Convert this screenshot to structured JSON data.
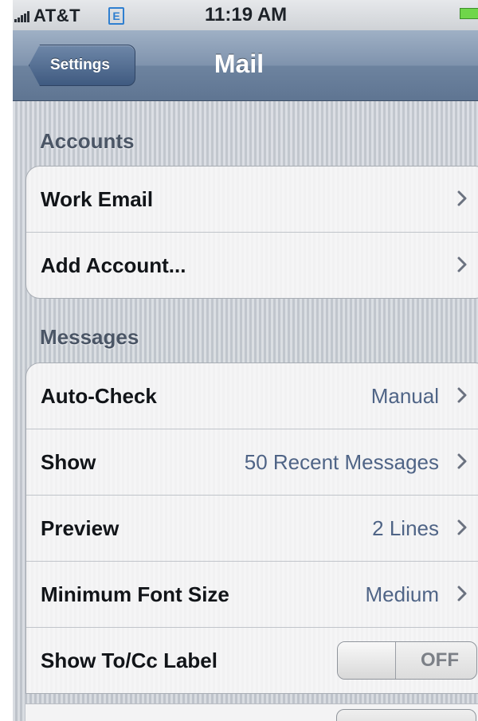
{
  "status_bar": {
    "carrier": "AT&T",
    "network_badge": "E",
    "time": "11:19 AM",
    "signal_icon": "signal-bars-icon",
    "battery_icon": "battery-icon"
  },
  "nav": {
    "back_label": "Settings",
    "title": "Mail"
  },
  "sections": [
    {
      "header": "Accounts",
      "rows": [
        {
          "label": "Work Email",
          "value": "",
          "chevron": true
        },
        {
          "label": "Add Account...",
          "value": "",
          "chevron": true
        }
      ]
    },
    {
      "header": "Messages",
      "rows": [
        {
          "label": "Auto-Check",
          "value": "Manual",
          "chevron": true
        },
        {
          "label": "Show",
          "value": "50 Recent Messages",
          "chevron": true
        },
        {
          "label": "Preview",
          "value": "2 Lines",
          "chevron": true
        },
        {
          "label": "Minimum Font Size",
          "value": "Medium",
          "chevron": true
        },
        {
          "label": "Show To/Cc Label",
          "toggle": "OFF"
        }
      ]
    }
  ],
  "colors": {
    "nav_bar": "#7f93ad",
    "value_text": "#4f6486",
    "section_header": "#4b5666",
    "battery": "#6fd64a",
    "edge_badge": "#2f7fd0"
  }
}
